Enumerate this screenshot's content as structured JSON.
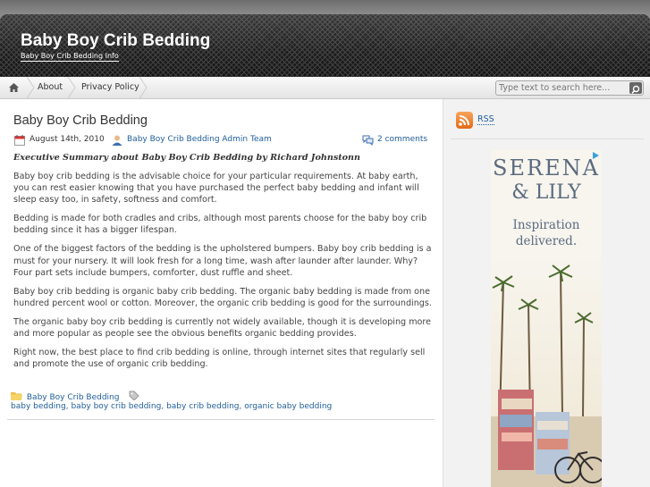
{
  "site": {
    "title": "Baby Boy Crib Bedding",
    "description": "Baby Boy Crib Bedding Info"
  },
  "nav": {
    "home_icon": "home-icon",
    "items": [
      "About",
      "Privacy Policy"
    ]
  },
  "search": {
    "placeholder": "Type text to search here..."
  },
  "post": {
    "title": "Baby Boy Crib Bedding",
    "date": "August 14th, 2010",
    "author": "Baby Boy Crib Bedding Admin Team",
    "comments": "2 comments",
    "paragraphs": [
      "Executive Summary about Baby Boy Crib Bedding by Richard Johnstonn",
      "Baby boy crib bedding is the advisable choice for your particular requirements. At baby earth, you can rest easier knowing that you have purchased the perfect baby bedding and infant will sleep easy too, in safety, softness and comfort.",
      "Bedding is made for both cradles and cribs, although most parents choose for the baby boy crib bedding since it has a bigger lifespan.",
      "One of the biggest factors of the bedding is the upholstered bumpers. Baby boy crib bedding is a must for your nursery. It will look fresh for a long time, wash after launder after launder. Why? Four part sets include bumpers, comforter, dust ruffle and sheet.",
      "Baby boy crib bedding is organic baby crib bedding. The organic baby bedding is made from one hundred percent wool or cotton. Moreover, the organic crib bedding is good for the surroundings.",
      "The organic baby boy crib bedding is currently not widely available, though it is developing more and more popular as people see the obvious benefits organic bedding provides.",
      "Right now, the best place to find crib bedding is online, through internet sites that regularly sell and promote the use of organic crib bedding."
    ],
    "category": "Baby Boy Crib Bedding",
    "tags": [
      "baby bedding",
      "baby boy crib bedding",
      "baby crib bedding",
      "organic baby bedding"
    ]
  },
  "sidebar": {
    "rss_label": "RSS",
    "ad": {
      "brand_line1": "SERENA",
      "brand_line2": "& LILY",
      "tagline1": "Inspiration",
      "tagline2": "delivered."
    }
  },
  "colors": {
    "link": "#1f5d9a",
    "rss": "#e8782c",
    "ad_text": "#5b6b7f",
    "header": "#1e1e1e"
  }
}
